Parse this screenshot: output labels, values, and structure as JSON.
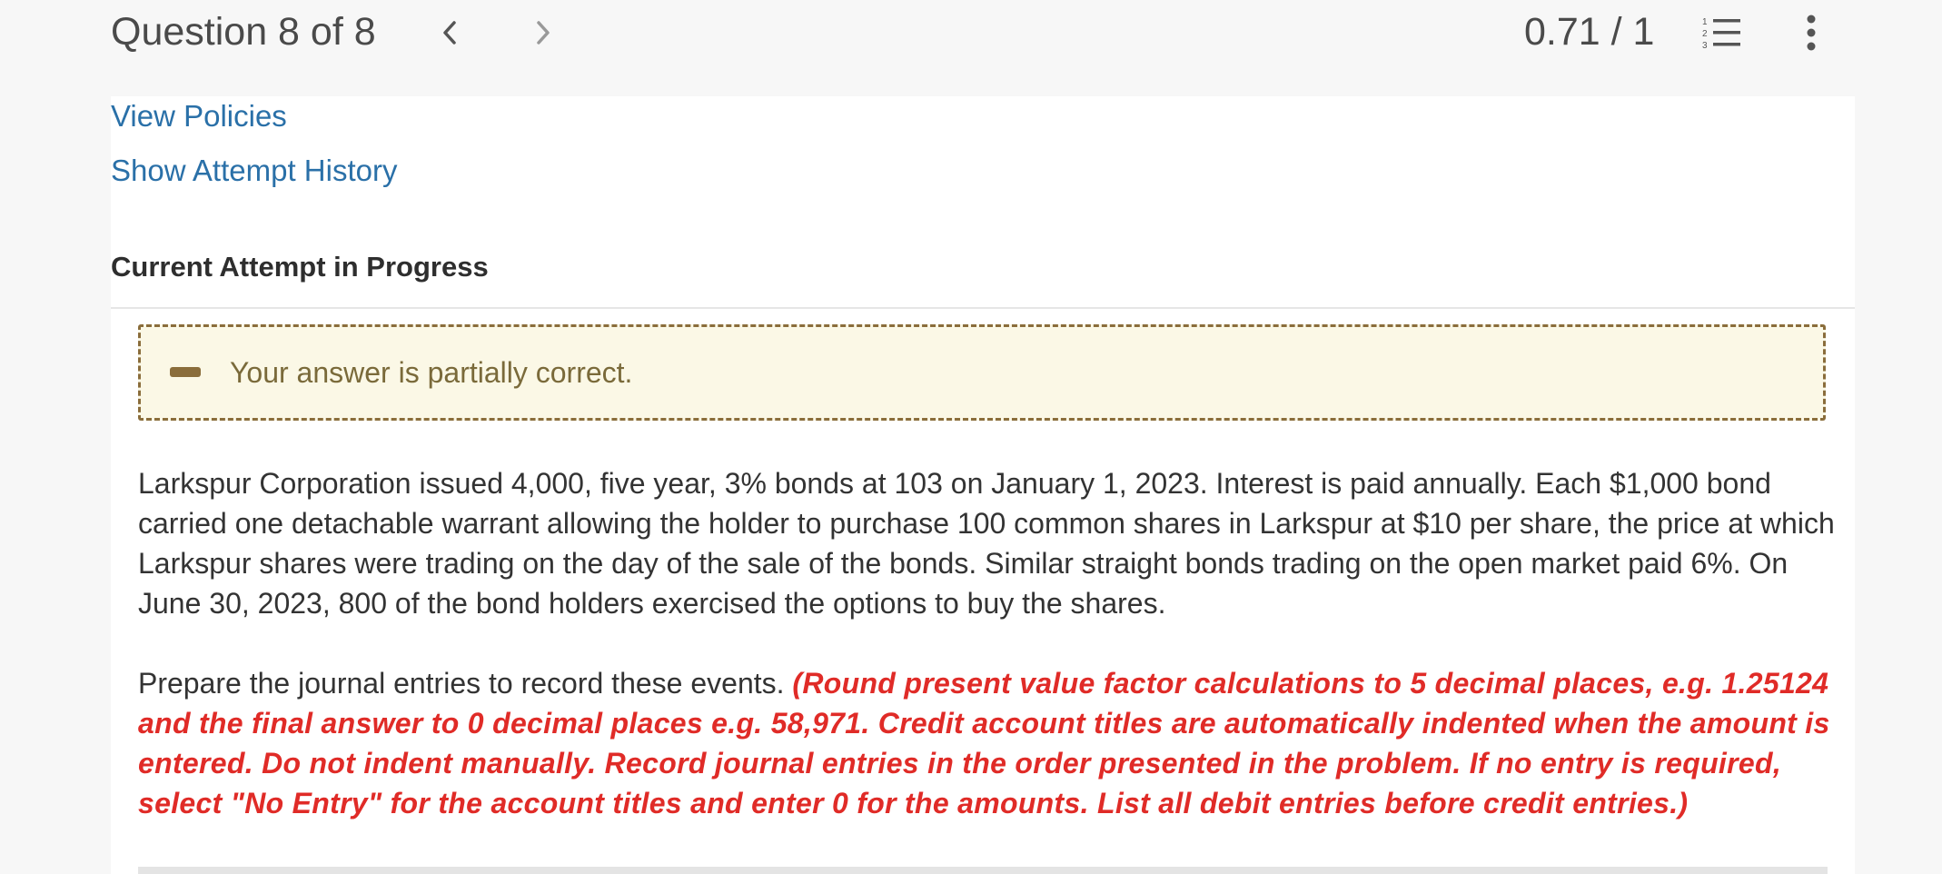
{
  "header": {
    "question_label": "Question 8 of 8",
    "score": "0.71 / 1",
    "icons": {
      "prev": "chevron-left-icon",
      "next": "chevron-right-icon",
      "list": "numbered-list-icon",
      "more": "more-vertical-icon"
    }
  },
  "links": {
    "view_policies": "View Policies",
    "show_attempt_history": "Show Attempt History"
  },
  "attempt": {
    "title": "Current Attempt in Progress"
  },
  "feedback": {
    "message": "Your answer is partially correct.",
    "icon": "partial-correct-icon",
    "border_color": "#8a6d3b",
    "background_color": "#fbf8e6"
  },
  "problem": {
    "paragraph1": "Larkspur Corporation issued 4,000, five year, 3% bonds at 103 on January 1, 2023. Interest is paid annually. Each $1,000 bond carried one detachable warrant allowing the holder to purchase 100 common shares in Larkspur at $10 per share, the price at which Larkspur shares were trading on the day of the sale of the bonds. Similar straight bonds trading on the open market paid 6%. On June 30, 2023, 800 of the bond holders exercised the options to buy the shares.",
    "prompt": "Prepare the journal entries to record these events.",
    "instructions": "(Round present value factor calculations to 5 decimal places, e.g. 1.25124 and the final answer to 0 decimal places e.g. 58,971. Credit account titles are automatically indented when the amount is entered. Do not indent manually. Record journal entries in the order presented in the problem. If no entry is required, select \"No Entry\" for the account titles and enter 0 for the amounts. List all debit entries before credit entries.)",
    "instruction_color": "#e02b27"
  }
}
